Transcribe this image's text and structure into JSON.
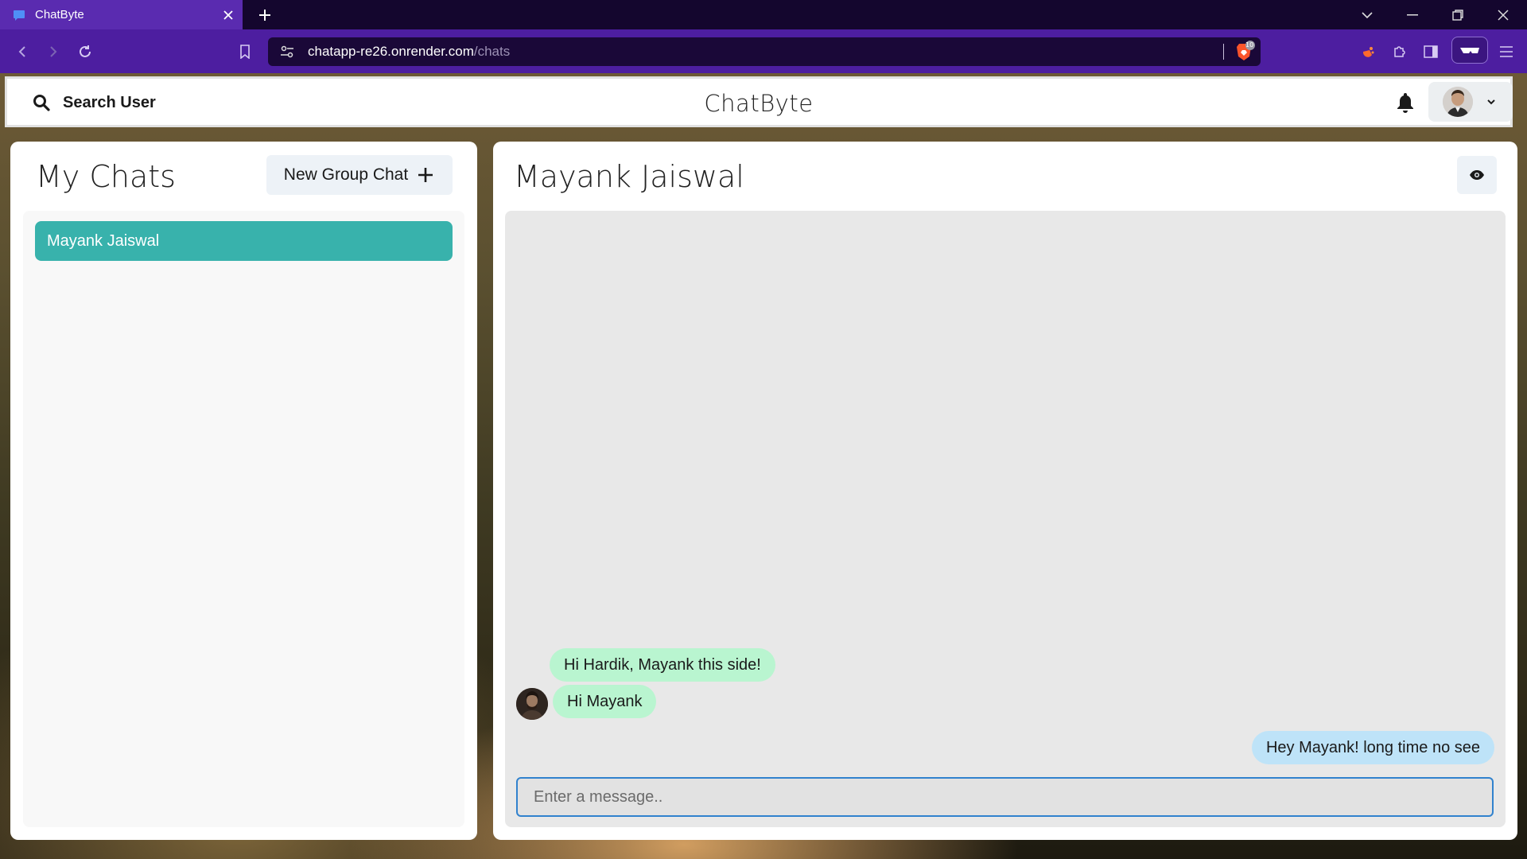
{
  "browser": {
    "tab_title": "ChatByte",
    "url_host": "chatapp-re26.onrender.com",
    "url_path": "/chats",
    "shield_count": "10"
  },
  "header": {
    "search_label": "Search User",
    "brand": "ChatByte"
  },
  "sidebar": {
    "title": "My Chats",
    "new_group_label": "New Group Chat",
    "chats": [
      {
        "name": "Mayank Jaiswal",
        "selected": true
      }
    ]
  },
  "chat": {
    "title": "Mayank Jaiswal",
    "messages": [
      {
        "sender": "them",
        "text": "Hi Hardik, Mayank this side!"
      },
      {
        "sender": "them",
        "text": "Hi Mayank"
      },
      {
        "sender": "me",
        "text": "Hey Mayank! long time no see"
      }
    ],
    "input_placeholder": "Enter a message.."
  },
  "colors": {
    "accent_teal": "#38b2ac",
    "bubble_incoming": "#b9f5d0",
    "bubble_outgoing": "#bee3f8",
    "browser_purple": "#4d1ea0"
  }
}
